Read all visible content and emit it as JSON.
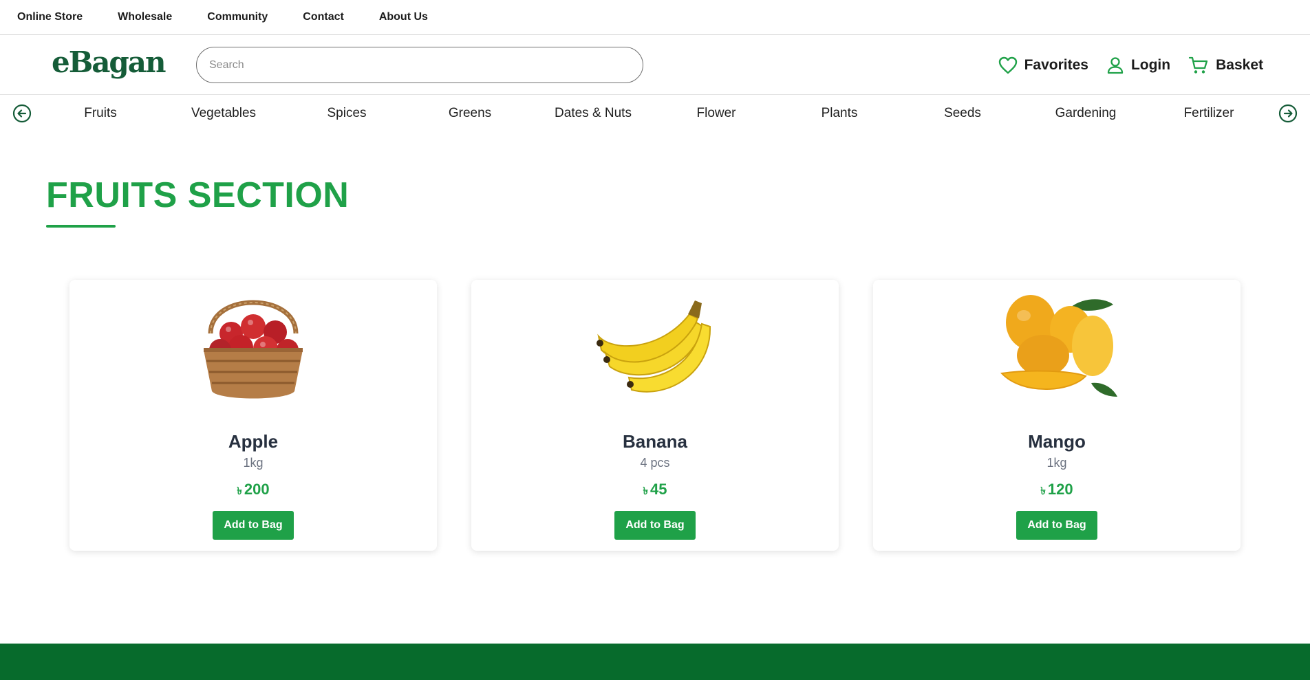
{
  "topnav": {
    "items": [
      "Online Store",
      "Wholesale",
      "Community",
      "Contact",
      "About Us"
    ]
  },
  "header": {
    "logo_text": "eBagan",
    "search_placeholder": "Search",
    "favorites_label": "Favorites",
    "login_label": "Login",
    "basket_label": "Basket"
  },
  "categories": {
    "items": [
      "Fruits",
      "Vegetables",
      "Spices",
      "Greens",
      "Dates & Nuts",
      "Flower",
      "Plants",
      "Seeds",
      "Gardening",
      "Fertilizer"
    ]
  },
  "section": {
    "title": "FRUITS SECTION"
  },
  "products": [
    {
      "name": "Apple",
      "unit": "1kg",
      "currency": "৳",
      "price": "200",
      "button": "Add to Bag"
    },
    {
      "name": "Banana",
      "unit": "4 pcs",
      "currency": "৳",
      "price": "45",
      "button": "Add to Bag"
    },
    {
      "name": "Mango",
      "unit": "1kg",
      "currency": "৳",
      "price": "120",
      "button": "Add to Bag"
    }
  ],
  "colors": {
    "brand_green": "#1fa148",
    "logo_green": "#155c38",
    "footer_green": "#076b2c"
  },
  "icons": {
    "favorites": "heart-icon",
    "login": "user-icon",
    "basket": "cart-icon",
    "prev": "arrow-left-circle-icon",
    "next": "arrow-right-circle-icon"
  }
}
